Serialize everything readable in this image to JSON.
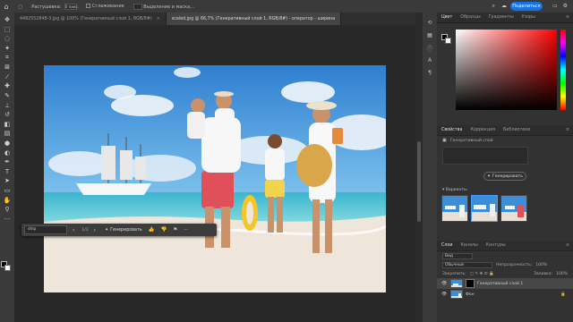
{
  "app": {
    "tool_options": {
      "feather_label": "Растушевка:",
      "feather_value": "0 пикс.",
      "antialias_label": "Сглаживание",
      "select_mask_label": "Выделение и маска..."
    },
    "share_label": "Поделиться"
  },
  "tabs": [
    {
      "label": "4482552848-3.jpg @ 100% (Генеративный слой 1, RGB/8#)",
      "active": false
    },
    {
      "label": "scaled.jpg @ 66,7% (Генеративный слой 1, RGB/8#) - оператор - ширина",
      "active": true
    }
  ],
  "contextual_taskbar": {
    "prompt_value": "ship",
    "counter": "1/3",
    "generate_label": "Генерировать"
  },
  "color_panel": {
    "tabs": [
      "Цвет",
      "Образцы",
      "Градиенты",
      "Узоры"
    ]
  },
  "properties_panel": {
    "tabs": [
      "Свойства",
      "Коррекция",
      "Библиотеки"
    ],
    "layer_type": "Генеративный слой",
    "generate_label": "Генерировать",
    "variants_title": "Варианты"
  },
  "layers_panel": {
    "tabs": [
      "Слои",
      "Каналы",
      "Контуры"
    ],
    "filter_label": "Вид",
    "blend_mode": "Обычные",
    "opacity_label": "Непрозрачность:",
    "opacity_value": "100%",
    "lock_label": "Закрепить:",
    "fill_label": "Заливка:",
    "fill_value": "100%",
    "layers": [
      {
        "name": "Генеративный слой 1",
        "selected": true
      },
      {
        "name": "Фон",
        "selected": false
      }
    ]
  },
  "icons": {
    "toolbar": [
      "move-icon",
      "marquee-icon",
      "lasso-icon",
      "magic-wand-icon",
      "crop-icon",
      "frame-icon",
      "eyedropper-icon",
      "healing-icon",
      "brush-icon",
      "clone-stamp-icon",
      "history-brush-icon",
      "eraser-icon",
      "gradient-icon",
      "blur-icon",
      "dodge-icon",
      "pen-icon",
      "type-icon",
      "path-select-icon",
      "shape-icon",
      "hand-icon",
      "zoom-icon",
      "more-icon"
    ]
  }
}
